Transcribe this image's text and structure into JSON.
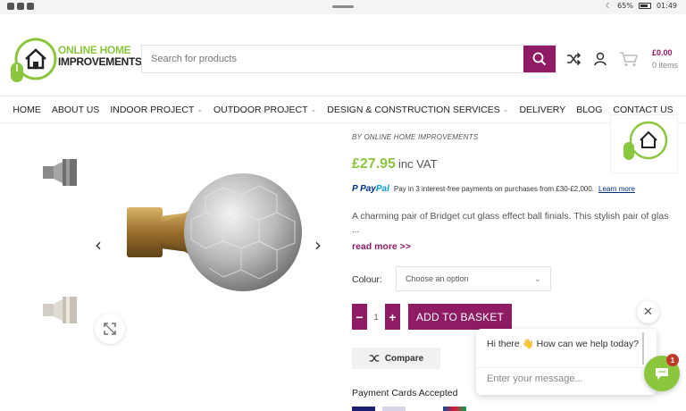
{
  "status_bar": {
    "battery": "65%",
    "time": "01:49"
  },
  "header": {
    "logo_line1": "ONLINE HOME",
    "logo_line2": "IMPROVEMENTS",
    "search_placeholder": "Search for products",
    "cart_total": "£0.00",
    "cart_items": "0 items"
  },
  "nav": {
    "items": [
      {
        "label": "HOME"
      },
      {
        "label": "ABOUT US"
      },
      {
        "label": "INDOOR PROJECT"
      },
      {
        "label": "OUTDOOR PROJECT"
      },
      {
        "label": "DESIGN & CONSTRUCTION SERVICES"
      },
      {
        "label": "DELIVERY"
      },
      {
        "label": "BLOG"
      },
      {
        "label": "CONTACT US"
      }
    ]
  },
  "product": {
    "by_line": "BY ONLINE HOME IMPROVEMENTS",
    "price": "£27.95",
    "price_suffix": "inc VAT",
    "paypal_text": "Pay in 3 interest-free payments on purchases from £30-£2,000.",
    "paypal_link": "Learn more",
    "description": "A charming pair of Bridget cut glass effect ball finials. This stylish pair of glas",
    "description_ellipsis": "...",
    "read_more": "read more >>",
    "colour_label": "Colour:",
    "colour_select": "Choose an option",
    "quantity": "1",
    "add_to_basket": "ADD TO BASKET",
    "compare": "Compare",
    "payment_title": "Payment Cards Accepted"
  },
  "chat": {
    "greeting": "Hi there 👋 How can we help today?",
    "input_placeholder": "Enter your message...",
    "badge": "1"
  },
  "colors": {
    "brand_purple": "#8e1b63",
    "brand_green": "#8cc63f"
  }
}
